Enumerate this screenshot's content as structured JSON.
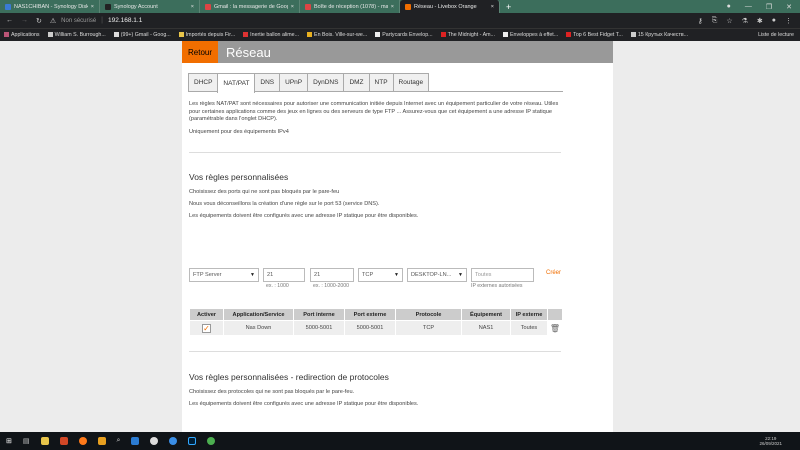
{
  "browser": {
    "tabs": [
      {
        "title": "NAS1CHIBAN - Synology DiskSt...",
        "color": "#3a7bd5"
      },
      {
        "title": "Synology Account",
        "color": "#222"
      },
      {
        "title": "Gmail : la messagerie de Google",
        "color": "#d44"
      },
      {
        "title": "Boîte de réception (1078) - mar...",
        "color": "#d44"
      },
      {
        "title": "Réseau - Livebox Orange",
        "color": "#f16e00",
        "active": true
      }
    ],
    "new_tab": "+",
    "security": "Non sécurisé",
    "url": "192.168.1.1",
    "bookmarks": [
      "Applications",
      "William S. Burrough...",
      "(99+) Gmail - Goog...",
      "Importés depuis Fir...",
      "Inertie ballon alime...",
      "En Bois. Ville-sur-we...",
      "Partycards Envelop...",
      "The Midnight - Am...",
      "Enveloppes à effet...",
      "Top 6 Best Fidget T...",
      "15 Крутых Качеств..."
    ],
    "reading_list": "Liste de lecture"
  },
  "page": {
    "back": "Retour",
    "title": "Réseau",
    "tabs": [
      "DHCP",
      "NAT/PAT",
      "DNS",
      "UPnP",
      "DynDNS",
      "DMZ",
      "NTP",
      "Routage"
    ],
    "intro": "Les règles NAT/PAT sont nécessaires pour autoriser une communication initiée depuis Internet avec un équipement particulier de votre réseau. Utiles pour certaines applications comme des jeux en lignes ou des serveurs de type FTP ... Assurez-vous que cet équipement a une adresse IP statique (paramétrable dans l'onglet DHCP).",
    "ipv4": "Uniquement pour des équipements IPv4",
    "section1": {
      "title": "Vos règles personnalisées",
      "lines": [
        "Choisissez des ports qui ne sont pas bloqués par le pare-feu",
        "Nous vous déconseillons la création d'une règle sur le port 53 (service DNS).",
        "Les équipements doivent être configurés avec une adresse IP statique pour être disponibles."
      ]
    },
    "form": {
      "service": "FTP Server",
      "internal_port": "21",
      "internal_hint": "ex. : 1000",
      "external_port": "21",
      "external_hint": "ex. : 1000-2000",
      "protocol": "TCP",
      "device": "DESKTOP-LN...",
      "ip_placeholder": "Toutes",
      "ip_hint": "IP externes autorisées",
      "create": "Créer"
    },
    "table": {
      "headers": [
        "Activer",
        "Application/Service",
        "Port interne",
        "Port externe",
        "Protocole",
        "Équipement",
        "IP externe"
      ],
      "rows": [
        {
          "active": true,
          "service": "Nas Down",
          "internal": "5000-5001",
          "external": "5000-5001",
          "protocol": "TCP",
          "device": "NAS1",
          "ip": "Toutes"
        }
      ]
    },
    "section2": {
      "title": "Vos règles personnalisées - redirection de protocoles",
      "lines": [
        "Choisissez des protocoles qui ne sont pas bloqués par le pare-feu.",
        "Les équipements doivent être configurés avec une adresse IP statique pour être disponibles."
      ]
    }
  },
  "taskbar": {
    "time": "22:19",
    "date": "26/09/2021"
  },
  "colors": {
    "accent": "#f16e00",
    "banner": "#999999"
  }
}
